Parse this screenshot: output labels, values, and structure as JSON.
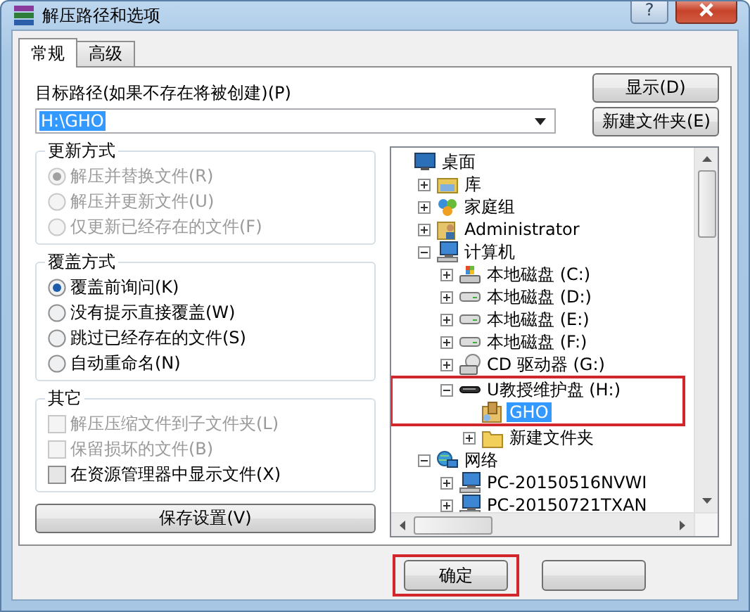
{
  "window": {
    "title": "解压路径和选项",
    "help_button": "?"
  },
  "tabs": [
    {
      "label": "常规",
      "selected": true
    },
    {
      "label": "高级",
      "selected": false
    }
  ],
  "destination": {
    "label": "目标路径(如果不存在将被创建)(P)",
    "value": "H:\\GHO"
  },
  "side_buttons": [
    "显示(D)",
    "新建文件夹(E)"
  ],
  "groups": [
    {
      "title": "更新方式",
      "kind": "radio",
      "items": [
        {
          "label": "解压并替换文件(R)",
          "selected": true,
          "disabled": true
        },
        {
          "label": "解压并更新文件(U)",
          "selected": false,
          "disabled": true
        },
        {
          "label": "仅更新已经存在的文件(F)",
          "selected": false,
          "disabled": true
        }
      ]
    },
    {
      "title": "覆盖方式",
      "kind": "radio",
      "items": [
        {
          "label": "覆盖前询问(K)",
          "selected": true,
          "disabled": false
        },
        {
          "label": "没有提示直接覆盖(W)",
          "selected": false,
          "disabled": false
        },
        {
          "label": "跳过已经存在的文件(S)",
          "selected": false,
          "disabled": false
        },
        {
          "label": "自动重命名(N)",
          "selected": false,
          "disabled": false
        }
      ]
    },
    {
      "title": "其它",
      "kind": "checkbox",
      "items": [
        {
          "label": "解压压缩文件到子文件夹(L)",
          "checked": false,
          "disabled": true
        },
        {
          "label": "保留损坏的文件(B)",
          "checked": false,
          "disabled": true
        },
        {
          "label": "在资源管理器中显示文件(X)",
          "checked": false,
          "disabled": false
        }
      ]
    }
  ],
  "save_button": "保存设置(V)",
  "tree": [
    {
      "label": "桌面",
      "kind": "desktop",
      "selected": false,
      "children": [
        {
          "label": "库",
          "kind": "library",
          "expanded": false,
          "selected": false
        },
        {
          "label": "家庭组",
          "kind": "homegroup",
          "expanded": false,
          "selected": false
        },
        {
          "label": "Administrator",
          "kind": "user",
          "expanded": false,
          "selected": false
        },
        {
          "label": "计算机",
          "kind": "computer",
          "expanded": true,
          "selected": false,
          "children": [
            {
              "label": "本地磁盘 (C:)",
              "kind": "system-drive",
              "expanded": false,
              "selected": false
            },
            {
              "label": "本地磁盘 (D:)",
              "kind": "drive",
              "expanded": false,
              "selected": false
            },
            {
              "label": "本地磁盘 (E:)",
              "kind": "drive",
              "expanded": false,
              "selected": false
            },
            {
              "label": "本地磁盘 (F:)",
              "kind": "drive",
              "expanded": false,
              "selected": false
            },
            {
              "label": "CD 驱动器 (G:)",
              "kind": "cd-drive",
              "expanded": false,
              "selected": false
            },
            {
              "label": "U教授维护盘 (H:)",
              "kind": "usb-drive",
              "expanded": true,
              "selected": false,
              "highlighted": true,
              "children": [
                {
                  "label": "GHO",
                  "kind": "package-folder",
                  "selected": true
                },
                {
                  "label": "新建文件夹",
                  "kind": "folder",
                  "expanded": false,
                  "selected": false
                }
              ]
            }
          ]
        },
        {
          "label": "网络",
          "kind": "network",
          "expanded": true,
          "selected": false,
          "children": [
            {
              "label": "PC-20150516NVWI",
              "kind": "computer",
              "expanded": false,
              "selected": false
            },
            {
              "label": "PC-20150721TXAN",
              "kind": "computer",
              "expanded": false,
              "selected": false
            }
          ]
        }
      ]
    }
  ],
  "bottom_buttons": [
    {
      "label": "确定",
      "highlighted": true
    },
    {
      "highlighted": false
    }
  ]
}
